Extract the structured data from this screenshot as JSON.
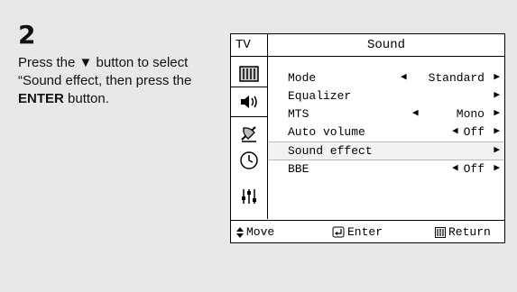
{
  "step": {
    "number": "2"
  },
  "instruction": {
    "line1": "Press the ",
    "arrow": "▼",
    "line2": " button to select “Sound effect, then press the ",
    "bold": "ENTER",
    "line3": " button."
  },
  "osd": {
    "tv_label": "TV",
    "title": "Sound",
    "icons": [
      "picture-icon",
      "sound-icon",
      "channel-icon",
      "clock-icon",
      "setup-icon"
    ],
    "active_icon": "sound-icon",
    "rows": [
      {
        "label": "Mode",
        "left_arrow": "◀",
        "value": "Standard",
        "right_arrow": "▶"
      },
      {
        "label": "Equalizer",
        "left_arrow": "",
        "value": "",
        "right_arrow": "▶"
      },
      {
        "label": "MTS",
        "left_arrow": "◀",
        "value": "Mono",
        "right_arrow": "▶"
      },
      {
        "label": "Auto volume",
        "left_arrow": "◀",
        "value": "Off",
        "right_arrow": "▶"
      },
      {
        "label": "Sound effect",
        "left_arrow": "",
        "value": "",
        "right_arrow": "▶",
        "selected": true
      },
      {
        "label": "BBE",
        "left_arrow": "◀",
        "value": "Off",
        "right_arrow": "▶"
      }
    ],
    "footer": {
      "move": "Move",
      "enter": "Enter",
      "return": "Return"
    }
  }
}
